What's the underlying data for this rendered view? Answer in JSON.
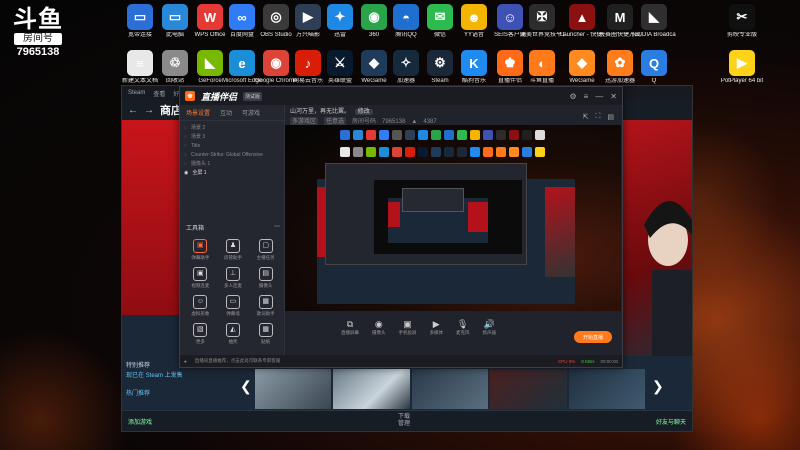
{
  "watermark": {
    "logo": "斗鱼",
    "room_label": "房间号",
    "room_number": "7965138"
  },
  "desktop_row1": [
    {
      "label": "宽带连接",
      "icon": "monitor-icon",
      "color": "#2b6fd6",
      "glyph": "▭"
    },
    {
      "label": "此电脑",
      "icon": "computer-icon",
      "color": "#2a88d8",
      "glyph": "▭"
    },
    {
      "label": "WPS Office",
      "icon": "wps-icon",
      "color": "#e53935",
      "glyph": "W"
    },
    {
      "label": "百度网盘",
      "icon": "baidu-netdisk-icon",
      "color": "#2f7cf6",
      "glyph": "∞"
    },
    {
      "label": "OBS Studio",
      "icon": "obs-icon",
      "color": "#3a3a3a",
      "glyph": "◎"
    },
    {
      "label": "万兴喵影",
      "icon": "filmora-icon",
      "color": "#2e3e55",
      "glyph": "▶"
    },
    {
      "label": "迅雷",
      "icon": "xunlei-icon",
      "color": "#1e88e5",
      "glyph": "✦"
    },
    {
      "label": "360",
      "icon": "360-icon",
      "color": "#2aa44a",
      "glyph": "◉"
    },
    {
      "label": "腾讯QQ",
      "icon": "qq-icon",
      "color": "#1e6fd0",
      "glyph": "◓"
    },
    {
      "label": "微信",
      "icon": "wechat-icon",
      "color": "#2dba4e",
      "glyph": "✉"
    },
    {
      "label": "YY语音",
      "icon": "yy-icon",
      "color": "#f4b400",
      "glyph": "☻"
    },
    {
      "label": "SEIS客户端",
      "icon": "seis-icon",
      "color": "#3f51b5",
      "glyph": "☺"
    },
    {
      "label": "完美世界竞技平台",
      "icon": "perfect-world-icon",
      "color": "#2c2c2c",
      "glyph": "✠"
    },
    {
      "label": "Launcher - 快捷方式",
      "icon": "launcher-icon",
      "color": "#8b1111",
      "glyph": "▲"
    },
    {
      "label": "决赛圈快捷方式",
      "icon": "mw-icon",
      "color": "#202020",
      "glyph": "M"
    },
    {
      "label": "NVIDIA Broadcast",
      "icon": "nvidia-icon",
      "color": "#2f2f2f",
      "glyph": "◣"
    },
    {
      "label": "剪映专业版",
      "icon": "capcut-icon",
      "color": "#101010",
      "glyph": "✂"
    }
  ],
  "desktop_row2": [
    {
      "label": "新建文本文档",
      "icon": "text-file-icon",
      "color": "#e8e8e8",
      "glyph": "≡"
    },
    {
      "label": "回收站",
      "icon": "recycle-bin-icon",
      "color": "#8a8a8a",
      "glyph": "♲"
    },
    {
      "label": "GeForce",
      "icon": "geforce-icon",
      "color": "#76b900",
      "glyph": "◣"
    },
    {
      "label": "Microsoft Edge",
      "icon": "edge-icon",
      "color": "#1a8fd8",
      "glyph": "e"
    },
    {
      "label": "Google Chrome",
      "icon": "chrome-icon",
      "color": "#db4437",
      "glyph": "◉"
    },
    {
      "label": "网易云音乐",
      "icon": "netease-music-icon",
      "color": "#d81e06",
      "glyph": "♪"
    },
    {
      "label": "英雄联盟",
      "icon": "lol-icon",
      "color": "#0a1a2e",
      "glyph": "⚔"
    },
    {
      "label": "WeGame",
      "icon": "wegame-icon",
      "color": "#1f3b5a",
      "glyph": "◆"
    },
    {
      "label": "加速器",
      "icon": "accelerator-icon",
      "color": "#152a3d",
      "glyph": "✧"
    },
    {
      "label": "Steam",
      "icon": "steam-icon",
      "color": "#1b2838",
      "glyph": "⚙"
    },
    {
      "label": "酷狗音乐",
      "icon": "kugou-icon",
      "color": "#1f8bf0",
      "glyph": "K"
    },
    {
      "label": "直播伴侣",
      "icon": "live-companion-icon",
      "color": "#ff6a18",
      "glyph": "♚"
    },
    {
      "label": "斗鱼直播",
      "icon": "douyu-icon",
      "color": "#ff7a1a",
      "glyph": "◐"
    },
    {
      "label": "WeGame",
      "icon": "wegame2-icon",
      "color": "#ff8a1f",
      "glyph": "◆"
    },
    {
      "label": "迅游加速器",
      "icon": "xunyou-icon",
      "color": "#ff7c1a",
      "glyph": "✿"
    },
    {
      "label": "Q",
      "icon": "q-icon",
      "color": "#2a7de1",
      "glyph": "Q"
    },
    {
      "label": "PotPlayer 64 bit",
      "icon": "potplayer-icon",
      "color": "#ffd21a",
      "glyph": "▶"
    }
  ],
  "steam": {
    "top_menu": [
      "Steam",
      "查看",
      "好友",
      "游戏"
    ],
    "store_title": "商店",
    "list_title": "特别推荐",
    "list_items": [
      "现已在 Steam 上发售",
      "热门推荐"
    ],
    "bottom_left": "添加游戏",
    "bottom_mid": "下载",
    "bottom_mid_sub": "管理",
    "bottom_right": "好友与聊天"
  },
  "live": {
    "brand": "直播伴侣",
    "badge": "测试版",
    "tabs": [
      "场景设置",
      "互动",
      "可游戏"
    ],
    "scenes": [
      "场景 2",
      "场景 3",
      "Title",
      "Counter-Strike: Global Offensive",
      "摄像头 1",
      "全屏 1"
    ],
    "tools_title": "工具箱",
    "tools": [
      {
        "label": "弹幕助手",
        "glyph": "▣",
        "hot": true
      },
      {
        "label": "房管助手",
        "glyph": "♟",
        "hot": false
      },
      {
        "label": "主播任务",
        "glyph": "▢",
        "hot": false
      },
      {
        "label": "视频连麦",
        "glyph": "▣",
        "hot": false
      },
      {
        "label": "多人连麦",
        "glyph": "⊥",
        "hot": false
      },
      {
        "label": "摄像头",
        "glyph": "▤",
        "hot": false
      },
      {
        "label": "虚拟形象",
        "glyph": "☺",
        "hot": false
      },
      {
        "label": "弹幕墙",
        "glyph": "▭",
        "hot": false
      },
      {
        "label": "歌词助手",
        "glyph": "▦",
        "hot": false
      },
      {
        "label": "更多",
        "glyph": "▧",
        "hot": false
      },
      {
        "label": "抽奖",
        "glyph": "◭",
        "hot": false
      },
      {
        "label": "贴纸",
        "glyph": "▦",
        "hot": false
      }
    ],
    "stream_title": "山河万里，再无比翼。",
    "edit_label": "修改",
    "category": "多游戏区",
    "tag": "任意选",
    "room_label": "房间号码",
    "room_id": "7965138",
    "followers_icon": "flame-icon",
    "followers": "4387",
    "toolbar": [
      {
        "label": "直播屏幕",
        "glyph": "⧉"
      },
      {
        "label": "摄像头",
        "glyph": "◉"
      },
      {
        "label": "手机投屏",
        "glyph": "▣"
      },
      {
        "label": "多媒体",
        "glyph": "▶"
      },
      {
        "label": "麦克风",
        "glyph": "🎙"
      },
      {
        "label": "扬声器",
        "glyph": "🔊"
      }
    ],
    "start_button": "开始直播",
    "status_warn": "直播间直播推荐，点击此处可联系专职客服",
    "status_cpu": "CPU 0%",
    "status_net": "0 KB/s",
    "status_time": "00:00:00"
  }
}
